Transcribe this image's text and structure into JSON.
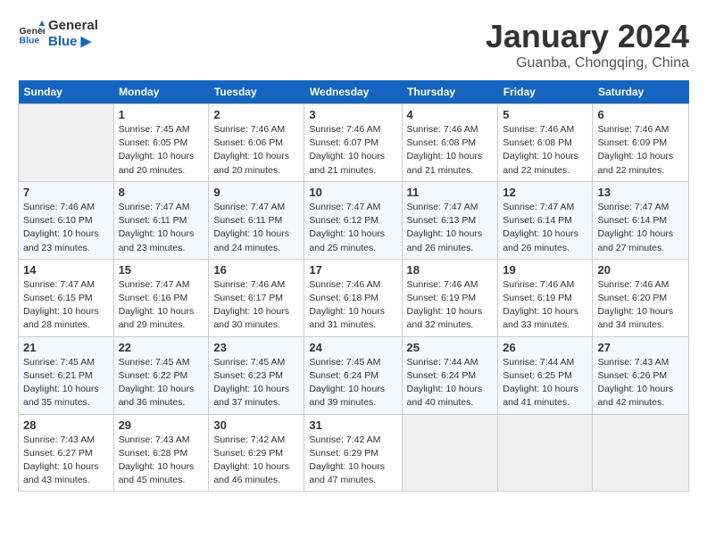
{
  "header": {
    "logo_line1": "General",
    "logo_line2": "Blue",
    "month": "January 2024",
    "location": "Guanba, Chongqing, China"
  },
  "weekdays": [
    "Sunday",
    "Monday",
    "Tuesday",
    "Wednesday",
    "Thursday",
    "Friday",
    "Saturday"
  ],
  "weeks": [
    [
      {
        "day": "",
        "info": ""
      },
      {
        "day": "1",
        "info": "Sunrise: 7:45 AM\nSunset: 6:05 PM\nDaylight: 10 hours\nand 20 minutes."
      },
      {
        "day": "2",
        "info": "Sunrise: 7:46 AM\nSunset: 6:06 PM\nDaylight: 10 hours\nand 20 minutes."
      },
      {
        "day": "3",
        "info": "Sunrise: 7:46 AM\nSunset: 6:07 PM\nDaylight: 10 hours\nand 21 minutes."
      },
      {
        "day": "4",
        "info": "Sunrise: 7:46 AM\nSunset: 6:08 PM\nDaylight: 10 hours\nand 21 minutes."
      },
      {
        "day": "5",
        "info": "Sunrise: 7:46 AM\nSunset: 6:08 PM\nDaylight: 10 hours\nand 22 minutes."
      },
      {
        "day": "6",
        "info": "Sunrise: 7:46 AM\nSunset: 6:09 PM\nDaylight: 10 hours\nand 22 minutes."
      }
    ],
    [
      {
        "day": "7",
        "info": "Sunrise: 7:46 AM\nSunset: 6:10 PM\nDaylight: 10 hours\nand 23 minutes."
      },
      {
        "day": "8",
        "info": "Sunrise: 7:47 AM\nSunset: 6:11 PM\nDaylight: 10 hours\nand 23 minutes."
      },
      {
        "day": "9",
        "info": "Sunrise: 7:47 AM\nSunset: 6:11 PM\nDaylight: 10 hours\nand 24 minutes."
      },
      {
        "day": "10",
        "info": "Sunrise: 7:47 AM\nSunset: 6:12 PM\nDaylight: 10 hours\nand 25 minutes."
      },
      {
        "day": "11",
        "info": "Sunrise: 7:47 AM\nSunset: 6:13 PM\nDaylight: 10 hours\nand 26 minutes."
      },
      {
        "day": "12",
        "info": "Sunrise: 7:47 AM\nSunset: 6:14 PM\nDaylight: 10 hours\nand 26 minutes."
      },
      {
        "day": "13",
        "info": "Sunrise: 7:47 AM\nSunset: 6:14 PM\nDaylight: 10 hours\nand 27 minutes."
      }
    ],
    [
      {
        "day": "14",
        "info": "Sunrise: 7:47 AM\nSunset: 6:15 PM\nDaylight: 10 hours\nand 28 minutes."
      },
      {
        "day": "15",
        "info": "Sunrise: 7:47 AM\nSunset: 6:16 PM\nDaylight: 10 hours\nand 29 minutes."
      },
      {
        "day": "16",
        "info": "Sunrise: 7:46 AM\nSunset: 6:17 PM\nDaylight: 10 hours\nand 30 minutes."
      },
      {
        "day": "17",
        "info": "Sunrise: 7:46 AM\nSunset: 6:18 PM\nDaylight: 10 hours\nand 31 minutes."
      },
      {
        "day": "18",
        "info": "Sunrise: 7:46 AM\nSunset: 6:19 PM\nDaylight: 10 hours\nand 32 minutes."
      },
      {
        "day": "19",
        "info": "Sunrise: 7:46 AM\nSunset: 6:19 PM\nDaylight: 10 hours\nand 33 minutes."
      },
      {
        "day": "20",
        "info": "Sunrise: 7:46 AM\nSunset: 6:20 PM\nDaylight: 10 hours\nand 34 minutes."
      }
    ],
    [
      {
        "day": "21",
        "info": "Sunrise: 7:45 AM\nSunset: 6:21 PM\nDaylight: 10 hours\nand 35 minutes."
      },
      {
        "day": "22",
        "info": "Sunrise: 7:45 AM\nSunset: 6:22 PM\nDaylight: 10 hours\nand 36 minutes."
      },
      {
        "day": "23",
        "info": "Sunrise: 7:45 AM\nSunset: 6:23 PM\nDaylight: 10 hours\nand 37 minutes."
      },
      {
        "day": "24",
        "info": "Sunrise: 7:45 AM\nSunset: 6:24 PM\nDaylight: 10 hours\nand 39 minutes."
      },
      {
        "day": "25",
        "info": "Sunrise: 7:44 AM\nSunset: 6:24 PM\nDaylight: 10 hours\nand 40 minutes."
      },
      {
        "day": "26",
        "info": "Sunrise: 7:44 AM\nSunset: 6:25 PM\nDaylight: 10 hours\nand 41 minutes."
      },
      {
        "day": "27",
        "info": "Sunrise: 7:43 AM\nSunset: 6:26 PM\nDaylight: 10 hours\nand 42 minutes."
      }
    ],
    [
      {
        "day": "28",
        "info": "Sunrise: 7:43 AM\nSunset: 6:27 PM\nDaylight: 10 hours\nand 43 minutes."
      },
      {
        "day": "29",
        "info": "Sunrise: 7:43 AM\nSunset: 6:28 PM\nDaylight: 10 hours\nand 45 minutes."
      },
      {
        "day": "30",
        "info": "Sunrise: 7:42 AM\nSunset: 6:29 PM\nDaylight: 10 hours\nand 46 minutes."
      },
      {
        "day": "31",
        "info": "Sunrise: 7:42 AM\nSunset: 6:29 PM\nDaylight: 10 hours\nand 47 minutes."
      },
      {
        "day": "",
        "info": ""
      },
      {
        "day": "",
        "info": ""
      },
      {
        "day": "",
        "info": ""
      }
    ]
  ]
}
